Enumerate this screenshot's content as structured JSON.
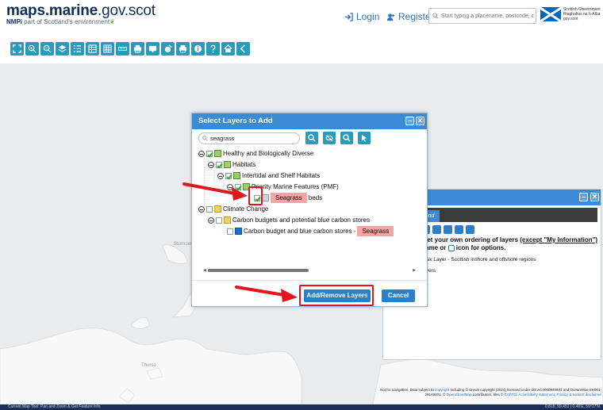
{
  "header": {
    "logo_bold": "maps.marine",
    "logo_light": ".gov.scot",
    "logo_sub_bold": "NMPi",
    "logo_sub": " part of Scotland's environment",
    "login_label": "Login",
    "register_label": "Register",
    "search_placeholder": "Start typing a placename, postcode, c",
    "gov_text": "Scottish Government Riaghaltas na h-Alba gov.scot"
  },
  "toolbar": {
    "icons": [
      "fullscreen-icon",
      "zoom-in-icon",
      "zoom-out-icon",
      "layers-icon",
      "legend-icon",
      "data-table-icon",
      "grid-icon",
      "measure-icon",
      "print-map-icon",
      "bookmark-icon",
      "draw-icon",
      "print-icon",
      "info-icon",
      "help-icon",
      "home-icon",
      "collapse-icon"
    ]
  },
  "dialog": {
    "title": "Select Layers to Add",
    "search_value": "seagrass",
    "tree": [
      {
        "label": "Healthy and Biologically Diverse",
        "checked": true
      },
      {
        "label": "Habitats",
        "checked": true
      },
      {
        "label": "Intertidal and Shelf Habitats",
        "checked": true
      },
      {
        "label": "Priority Marine Features (PMF)",
        "checked": true
      },
      {
        "label_highlight": "Seagrass",
        "label_rest": " beds",
        "checked": true
      },
      {
        "label": "Climate Change",
        "checked": false
      },
      {
        "label": "Carbon budgets and potential blue carbon stores",
        "checked": false
      },
      {
        "label": "Carbon budget and blue carbon stores - ",
        "label_highlight": "Seagrass",
        "checked": false
      }
    ],
    "add_remove_label": "Add/Remove Layers",
    "cancel_label": "Cancel"
  },
  "map_control": {
    "title": "trol",
    "tab_label": "Legend",
    "instructions_line1a": "p to set your own ordering of layers ",
    "instructions_line1b": "(except \"My Information\")",
    "instructions_line2": "yer name or ",
    "instructions_line2b": " icon for options.",
    "mask_layer": "Mask Layer - Scottish inshore and offshore regions",
    "base_layers": "se Layers"
  },
  "map": {
    "label_thurso": "Thurso",
    "label_stornoway": "Stornoway",
    "attribution_line1a": "Not for navigation. Data subject to ",
    "attribution_link1": "copyright",
    "attribution_line1b": " including © Crown copyright (2024) licensed under OS AC0000849481 and OceanWise EK001-",
    "attribution_line2a": "20146401. © ",
    "attribution_link2": "OpenStreetMap",
    "attribution_line2b": " contributors, tiles © ",
    "attribution_link3": "CARTO",
    "attribution_line2c": ". ",
    "attribution_link4": "Accessibility statement",
    "attribution_link5": "Privacy & content disclaimer"
  },
  "status": {
    "text": "Current Map Tool: Pan and Zoom & Get Feature Info",
    "coords": "0.818, 59.451 | 0.49'E, 59°27'N"
  },
  "colors": {
    "accent": "#3a8bd4",
    "toolbar_button": "#2b9ab8",
    "highlight": "#f6a3a3",
    "annotation_red": "#e3151c"
  }
}
